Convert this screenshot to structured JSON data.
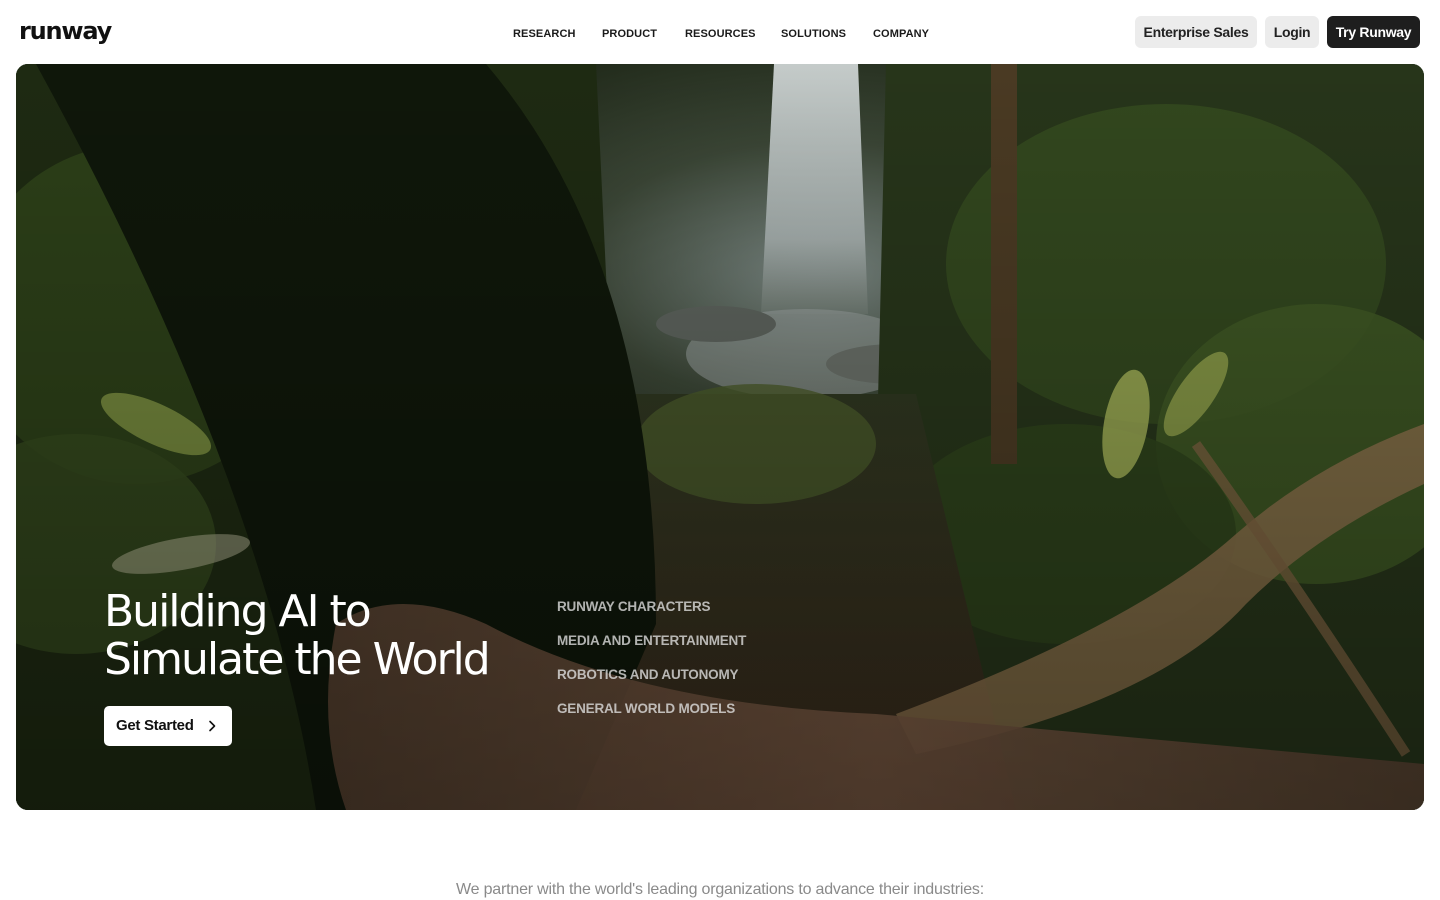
{
  "header": {
    "logo": "runway",
    "nav": [
      "RESEARCH",
      "PRODUCT",
      "RESOURCES",
      "SOLUTIONS",
      "COMPANY"
    ],
    "enterprise_label": "Enterprise Sales",
    "login_label": "Login",
    "try_label": "Try Runway"
  },
  "hero": {
    "title_line1": "Building AI to",
    "title_line2": "Simulate the World",
    "cta_label": "Get Started",
    "cta_icon": "chevron-right-icon",
    "links": [
      "RUNWAY CHARACTERS",
      "MEDIA AND ENTERTAINMENT",
      "ROBOTICS AND AUTONOMY",
      "GENERAL WORLD MODELS"
    ]
  },
  "partners": {
    "text": "We partner with the world's leading organizations to advance their industries:"
  },
  "colors": {
    "primary_button": "#1e1e1e",
    "secondary_button": "#ececec",
    "body_text": "#111111",
    "muted_text": "#8a8a8a"
  }
}
